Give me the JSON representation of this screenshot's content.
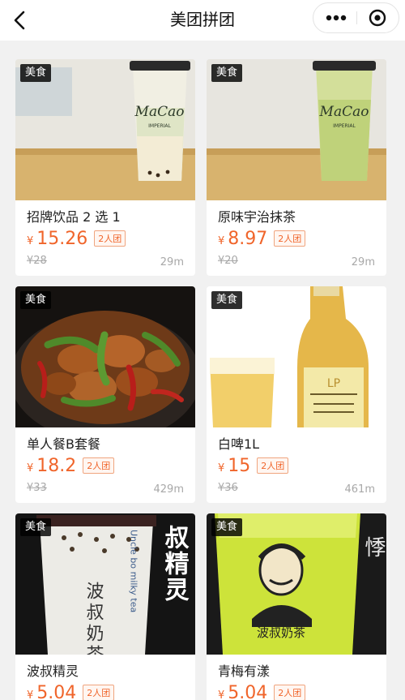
{
  "nav": {
    "title": "美团拼团",
    "back_icon": "chevron-left-icon",
    "more_icon": "more-dots-icon",
    "close_icon": "target-close-icon"
  },
  "colors": {
    "price": "#f0652b",
    "tag_bg": "#000000",
    "page_bg": "#f1f1f1"
  },
  "products": [
    {
      "tag": "美食",
      "name": "招牌饮品 2 选 1",
      "currency": "¥",
      "price": "15.26",
      "group": "2人团",
      "original": "¥28",
      "distance": "29m",
      "image": "milk-tea-cup"
    },
    {
      "tag": "美食",
      "name": "原味宇治抹茶",
      "currency": "¥",
      "price": "8.97",
      "group": "2人团",
      "original": "¥20",
      "distance": "29m",
      "image": "matcha-cup"
    },
    {
      "tag": "美食",
      "name": "单人餐B套餐",
      "currency": "¥",
      "price": "18.2",
      "group": "2人团",
      "original": "¥33",
      "distance": "429m",
      "image": "braised-chicken-pot"
    },
    {
      "tag": "美食",
      "name": "白啤1L",
      "currency": "¥",
      "price": "15",
      "group": "2人团",
      "original": "¥36",
      "distance": "461m",
      "image": "beer-bottle-glass"
    },
    {
      "tag": "美食",
      "name": "波叔精灵",
      "currency": "¥",
      "price": "5.04",
      "group": "2人团",
      "original": "",
      "distance": "",
      "image": "bubble-tea-poster"
    },
    {
      "tag": "美食",
      "name": "青梅有漾",
      "currency": "¥",
      "price": "5.04",
      "group": "2人团",
      "original": "",
      "distance": "",
      "image": "green-plum-drink"
    }
  ],
  "poster_text": {
    "bosu_big": "叔精灵",
    "bosu_cup": "波叔奶茶",
    "bosu_side": "Uncle bo milky tea",
    "plum_cup": "波叔奶茶",
    "plum_side": "悸"
  }
}
